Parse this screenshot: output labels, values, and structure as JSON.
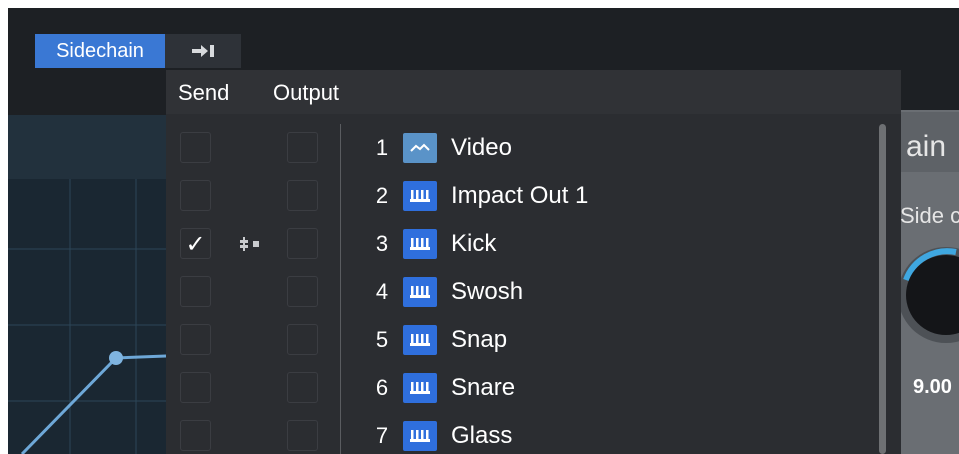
{
  "tabs": {
    "sidechain_label": "Sidechain",
    "route_icon": "route-arrow-icon"
  },
  "menu": {
    "send_label": "Send",
    "output_label": "Output"
  },
  "right_panel": {
    "title_fragment": "ain",
    "side_label": "Side c",
    "knob_value": "9.00"
  },
  "colors": {
    "accent": "#3a78d4",
    "audio_track": "#5a93c8",
    "instrument_track": "#2f6fdd"
  },
  "tracks": [
    {
      "num": "1",
      "name": "Video",
      "type": "audio",
      "icon": "audio-waveform-icon",
      "send_checked": false
    },
    {
      "num": "2",
      "name": "Impact Out 1",
      "type": "instrument",
      "icon": "keyboard-icon",
      "send_checked": false
    },
    {
      "num": "3",
      "name": "Kick",
      "type": "instrument",
      "icon": "keyboard-icon",
      "send_checked": true
    },
    {
      "num": "4",
      "name": "Swosh",
      "type": "instrument",
      "icon": "keyboard-icon",
      "send_checked": false
    },
    {
      "num": "5",
      "name": "Snap",
      "type": "instrument",
      "icon": "keyboard-icon",
      "send_checked": false
    },
    {
      "num": "6",
      "name": "Snare",
      "type": "instrument",
      "icon": "keyboard-icon",
      "send_checked": false
    },
    {
      "num": "7",
      "name": "Glass",
      "type": "instrument",
      "icon": "keyboard-icon",
      "send_checked": false
    }
  ]
}
